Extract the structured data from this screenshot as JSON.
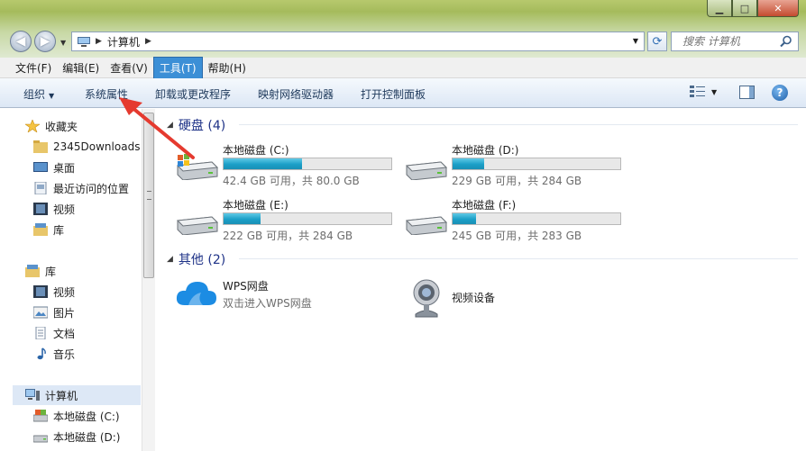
{
  "window": {
    "controls": {
      "minimize": "▁",
      "maximize": "□",
      "close": "✕"
    }
  },
  "address": {
    "crumb": "计算机",
    "search_placeholder": "搜索 计算机"
  },
  "menubar": [
    {
      "label": "文件(F)"
    },
    {
      "label": "编辑(E)"
    },
    {
      "label": "查看(V)"
    },
    {
      "label": "工具(T)",
      "active": true
    },
    {
      "label": "帮助(H)"
    }
  ],
  "toolbar": {
    "organize": "组织",
    "system_properties": "系统属性",
    "uninstall": "卸载或更改程序",
    "map_drive": "映射网络驱动器",
    "control_panel": "打开控制面板"
  },
  "navpane": {
    "favorites": "收藏夹",
    "fav_items": [
      "2345Downloads",
      "桌面",
      "最近访问的位置",
      "视频",
      "库"
    ],
    "libraries": "库",
    "lib_items": [
      "视频",
      "图片",
      "文档",
      "音乐"
    ],
    "computer": "计算机",
    "comp_items": [
      "本地磁盘 (C:)",
      "本地磁盘 (D:)"
    ]
  },
  "content": {
    "hdd_group": "硬盘 (4)",
    "other_group": "其他 (2)",
    "drives": [
      {
        "name": "本地磁盘 (C:)",
        "free": "42.4 GB 可用，共 80.0 GB",
        "used_fraction": 0.47
      },
      {
        "name": "本地磁盘 (D:)",
        "free": "229 GB 可用，共 284 GB",
        "used_fraction": 0.19
      },
      {
        "name": "本地磁盘 (E:)",
        "free": "222 GB 可用，共 284 GB",
        "used_fraction": 0.22
      },
      {
        "name": "本地磁盘 (F:)",
        "free": "245 GB 可用，共 283 GB",
        "used_fraction": 0.14
      }
    ],
    "others": [
      {
        "name": "WPS网盘",
        "desc": "双击进入WPS网盘",
        "icon": "cloud-icon"
      },
      {
        "name": "视频设备",
        "desc": "",
        "icon": "webcam-icon"
      }
    ]
  },
  "colors": {
    "accent": "#3c8fd6",
    "bar": "#1b9fc7",
    "annotation_arrow": "#e53a2f"
  }
}
